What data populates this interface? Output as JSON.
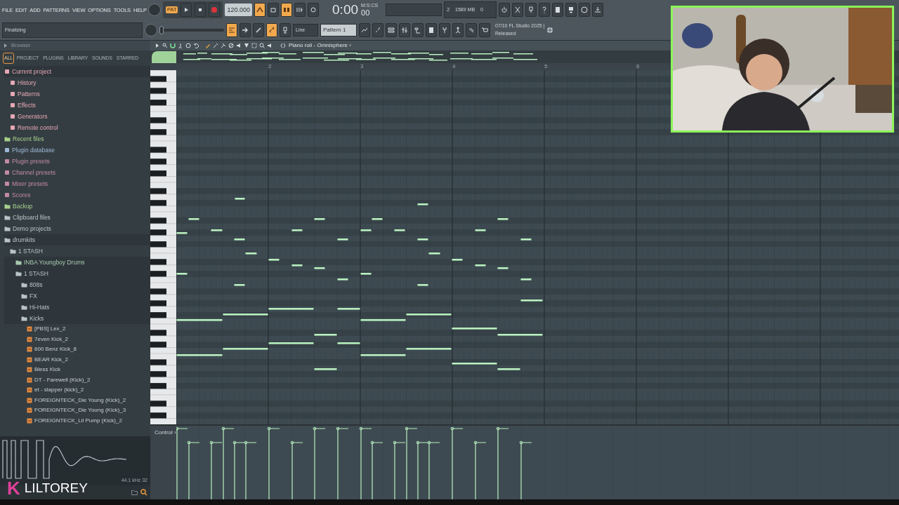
{
  "menu": [
    "FILE",
    "EDIT",
    "ADD",
    "PATTERNS",
    "VIEW",
    "OPTIONS",
    "TOOLS",
    "HELP"
  ],
  "status": "Finalizing",
  "transport": {
    "mode": "PAT",
    "mode_on": true,
    "tempo": "120.000"
  },
  "toggles_top": [
    {
      "on": true
    },
    {
      "on": false
    },
    {
      "on": true
    },
    {
      "on": false
    },
    {
      "on": false
    }
  ],
  "time": {
    "value": "0:00",
    "fraction": "00",
    "unit": "M:S:CS"
  },
  "cpu": {
    "voices": "2",
    "memory": "1589 MB",
    "polyphony": "0"
  },
  "toggles_bottom": [
    {
      "on": true
    },
    {
      "on": false
    },
    {
      "on": false
    },
    {
      "on": true
    },
    {
      "on": false
    }
  ],
  "pitch": {
    "level": 0
  },
  "snap": "Line",
  "pattern": "Pattern 1",
  "news": {
    "date": "07/10",
    "headline": "FL Studio 2025 |",
    "detail": "Released"
  },
  "browser": {
    "title": "Browser",
    "tabs": [
      {
        "label": "ALL",
        "selected": true
      },
      {
        "label": "PROJECT",
        "selected": false
      },
      {
        "label": "PLUGINS",
        "selected": false
      },
      {
        "label": "LIBRARY",
        "selected": false
      },
      {
        "label": "SOUNDS",
        "selected": false
      },
      {
        "label": "STARRED",
        "selected": false
      }
    ],
    "tree": [
      {
        "label": "Current project",
        "kind": "node",
        "color": "#e6a8b4",
        "children": [
          {
            "label": "History",
            "kind": "node",
            "color": "#e6a8b4"
          },
          {
            "label": "Patterns",
            "kind": "node",
            "color": "#e6a8b4"
          },
          {
            "label": "Effects",
            "kind": "node",
            "color": "#e6a8b4"
          },
          {
            "label": "Generators",
            "kind": "node",
            "color": "#e6a8b4"
          },
          {
            "label": "Remote control",
            "kind": "node",
            "color": "#e6a8b4"
          }
        ]
      },
      {
        "label": "Recent files",
        "kind": "folder",
        "color": "#a8d08c"
      },
      {
        "label": "Plugin database",
        "kind": "node",
        "color": "#9db8d6"
      },
      {
        "label": "Plugin presets",
        "kind": "node",
        "color": "#c38aa8"
      },
      {
        "label": "Channel presets",
        "kind": "node",
        "color": "#c38aa8"
      },
      {
        "label": "Mixer presets",
        "kind": "node",
        "color": "#c38aa8"
      },
      {
        "label": "Scores",
        "kind": "node",
        "color": "#c38aa8"
      },
      {
        "label": "Backup",
        "kind": "folder",
        "color": "#a8d08c"
      },
      {
        "label": "Clipboard files",
        "kind": "folder",
        "color": "#b8c3cb"
      },
      {
        "label": "Demo projects",
        "kind": "folder",
        "color": "#b8c3cb"
      },
      {
        "label": "drumkits",
        "kind": "folder",
        "color": "#b8c3cb",
        "children": [
          {
            "label": "1 STASH",
            "kind": "folder",
            "color": "#b8c3cb",
            "children": [
              {
                "label": "INBA Youngboy Drums",
                "kind": "folder",
                "color": "#a9c9b0"
              },
              {
                "label": "1 STASH",
                "kind": "folder",
                "color": "#b8c3cb",
                "children": [
                  {
                    "label": "808s",
                    "kind": "folder",
                    "color": "#b8c3cb"
                  },
                  {
                    "label": "FX",
                    "kind": "folder",
                    "color": "#b8c3cb"
                  },
                  {
                    "label": "Hi-Hats",
                    "kind": "folder",
                    "color": "#b8c3cb"
                  },
                  {
                    "label": "Kicks",
                    "kind": "folder",
                    "color": "#b8c3cb",
                    "children": [
                      {
                        "label": "[PBS] Lex_2",
                        "kind": "file"
                      },
                      {
                        "label": "7even Kick_2",
                        "kind": "file"
                      },
                      {
                        "label": "600 Benz Kick_8",
                        "kind": "file"
                      },
                      {
                        "label": "BEAR Kick_2",
                        "kind": "file"
                      },
                      {
                        "label": "Bless Kick",
                        "kind": "file"
                      },
                      {
                        "label": "DT - Farewell (Kick)_2",
                        "kind": "file"
                      },
                      {
                        "label": "et - slapper (kick)_2",
                        "kind": "file"
                      },
                      {
                        "label": "FOREIGNTECK_Die Young (Kick)_2",
                        "kind": "file"
                      },
                      {
                        "label": "FOREIGNTECK_Die Young (Kick)_3",
                        "kind": "file"
                      },
                      {
                        "label": "FOREIGNTECK_Lil Pump (Kick)_2",
                        "kind": "file"
                      }
                    ]
                  }
                ]
              }
            ]
          }
        ]
      }
    ],
    "preview": {
      "info": "44.1 kHz 32"
    }
  },
  "piano_roll": {
    "title": "Piano roll - Omnisphere ›",
    "bars": [
      "2",
      "3",
      "4",
      "5",
      "6"
    ],
    "control": "Control ›"
  },
  "overlay": {
    "logo_mark": "K",
    "channel_name": "LILTOREY"
  }
}
